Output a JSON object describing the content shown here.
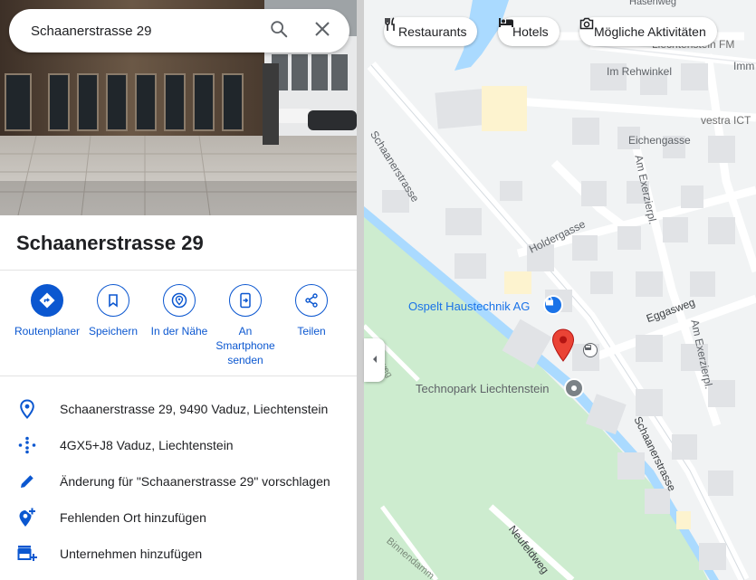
{
  "search": {
    "value": "Schaanerstrasse 29"
  },
  "place": {
    "title": "Schaanerstrasse 29"
  },
  "actions": [
    {
      "label": "Routenplaner",
      "icon": "directions-icon"
    },
    {
      "label": "Speichern",
      "icon": "bookmark-icon"
    },
    {
      "label": "In der Nähe",
      "icon": "nearby-icon"
    },
    {
      "label": "An Smartphone senden",
      "icon": "send-to-phone-icon"
    },
    {
      "label": "Teilen",
      "icon": "share-icon"
    }
  ],
  "info": [
    {
      "text": "Schaanerstrasse 29, 9490 Vaduz, Liechtenstein",
      "icon": "location-pin-icon"
    },
    {
      "text": "4GX5+J8 Vaduz, Liechtenstein",
      "icon": "plus-code-icon"
    },
    {
      "text": "Änderung für \"Schaanerstrasse 29\" vorschlagen",
      "icon": "edit-pencil-icon"
    },
    {
      "text": "Fehlenden Ort hinzufügen",
      "icon": "add-location-icon"
    },
    {
      "text": "Unternehmen hinzufügen",
      "icon": "add-business-icon"
    }
  ],
  "chips": [
    {
      "label": "Restaurants",
      "icon": "restaurant-icon"
    },
    {
      "label": "Hotels",
      "icon": "hotel-icon"
    },
    {
      "label": "Mögliche Aktivitäten",
      "icon": "camera-icon"
    }
  ],
  "map_labels": {
    "hasenweg": "Hasenweg",
    "im_rehwinkel": "Im Rehwinkel",
    "imm": "Imm",
    "liechtenstein_fm": "Liechtenstein FM",
    "vestra": "vestra ICT",
    "eichengasse": "Eichengasse",
    "schaanerstrasse_top": "Schaanerstrasse",
    "am_exerzierpl_1": "Am Exerzierpl.",
    "holdergasse": "Holdergasse",
    "ospelt": "Ospelt Haustechnik AG",
    "eggasweg": "Eggasweg",
    "am_exerzierpl_2": "Am Exerzierpl.",
    "technopark": "Technopark Liechtenstein",
    "schaanerstrasse_bottom": "Schaanerstrasse",
    "neufeldweg": "Neufeldweg",
    "binnendamm": "Binnendamm",
    "small_road": "weg"
  },
  "colors": {
    "accent": "#0b57d0",
    "map_background": "#f1f3f4",
    "park": "#cdeccf",
    "water": "#aadaff",
    "pin": "#ea4335"
  }
}
